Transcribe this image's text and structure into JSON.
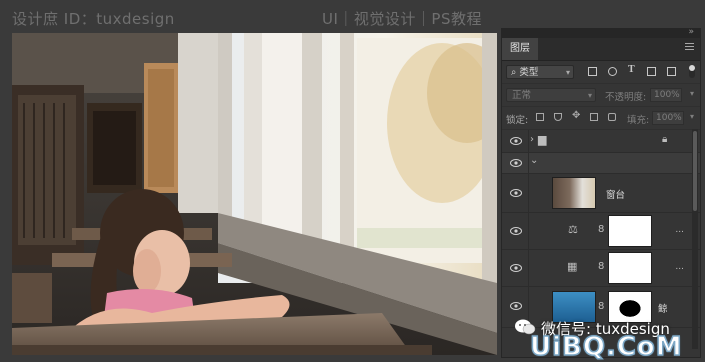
{
  "watermark": {
    "left": "设计庶 ID：tuxdesign",
    "right": "UI｜视觉设计｜PS教程",
    "wechat": "微信号: tuxdesign",
    "site": "UiBQ.CoM"
  },
  "panel": {
    "collapse_icon": "»",
    "tab": "图层",
    "filter_kind": "类型",
    "filter_icons": [
      "image-filter-icon",
      "adjustment-filter-icon",
      "type-filter-icon",
      "shape-filter-icon",
      "smartobject-filter-icon"
    ],
    "type_glyph": "T",
    "blend_mode": "正常",
    "opacity_label": "不透明度:",
    "opacity_value": "100%",
    "lock_label": "锁定:",
    "fill_label": "填充:",
    "fill_value": "100%"
  },
  "layers": [
    {
      "kind": "group",
      "name": "",
      "locked": true
    },
    {
      "kind": "group-open",
      "name": ""
    },
    {
      "kind": "smart",
      "name": "窗台"
    },
    {
      "kind": "adjust",
      "icon": "balance-icon",
      "more": "..."
    },
    {
      "kind": "adjust",
      "icon": "gradient-map-icon",
      "more": "..."
    },
    {
      "kind": "image",
      "name": "鲸",
      "more": "..."
    }
  ],
  "colors": {
    "panel_bg": "#353535",
    "canvas_bg": "#3a3a3a",
    "accent": "#7da8c6"
  }
}
